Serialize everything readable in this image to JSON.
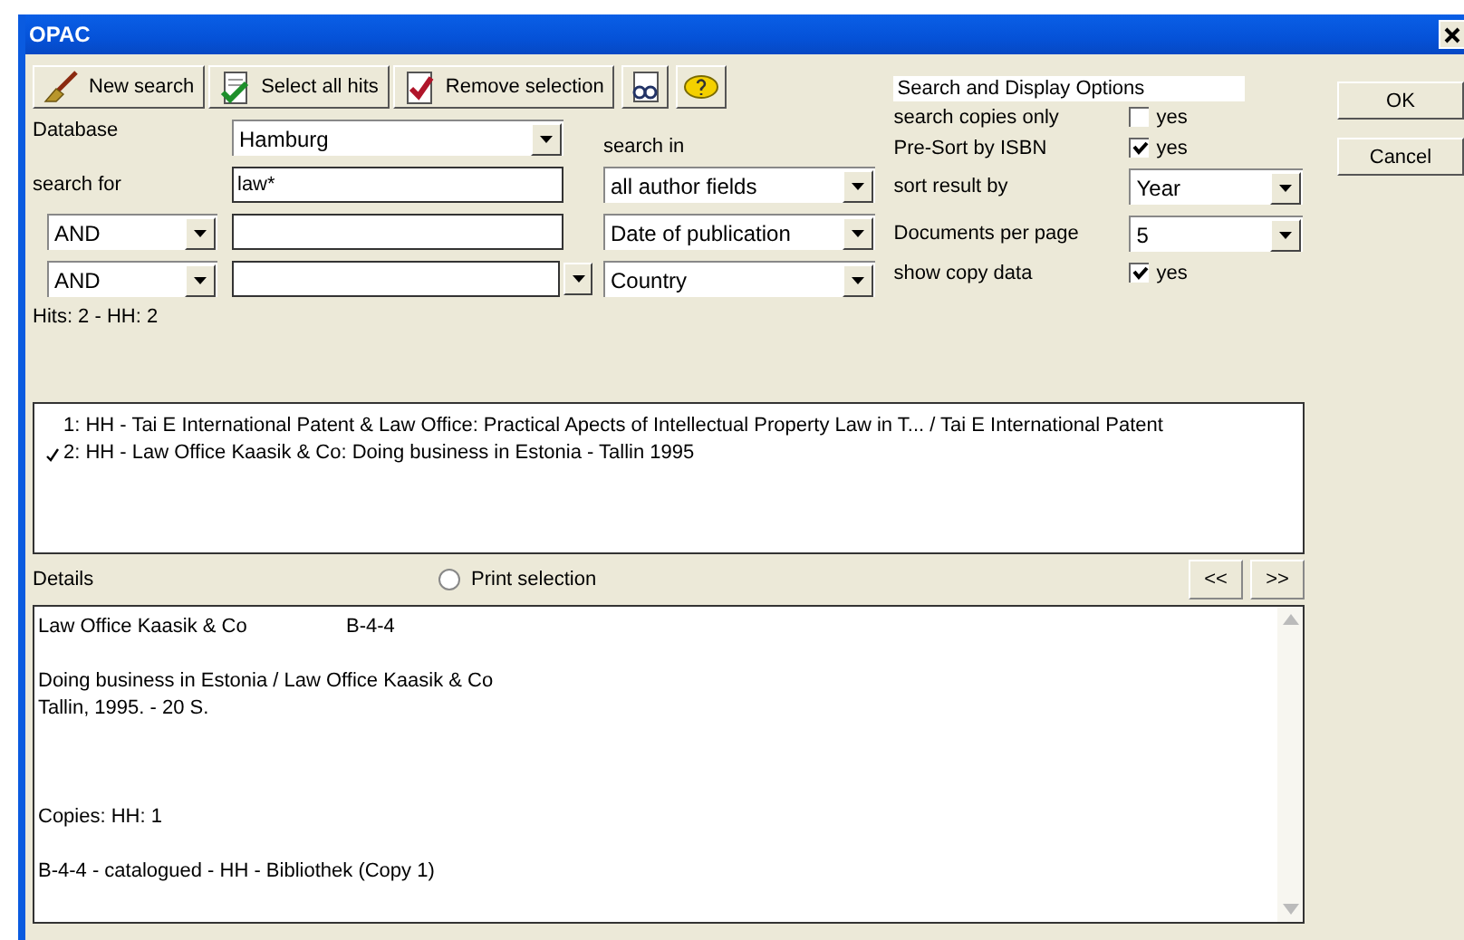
{
  "window": {
    "title": "OPAC"
  },
  "toolbar": {
    "buttons": [
      {
        "label": "New search"
      },
      {
        "label": "Select all hits"
      },
      {
        "label": "Remove selection"
      }
    ]
  },
  "search": {
    "database_label": "Database",
    "database": "Hamburg",
    "search_for_label": "search for",
    "query": "law*",
    "search_in_label": "search in",
    "rows": [
      {
        "field": "all author fields"
      },
      {
        "operator": "AND",
        "value": "",
        "field": "Date of publication"
      },
      {
        "operator": "AND",
        "value": "",
        "field": "Country"
      }
    ]
  },
  "options": {
    "title": "Search and Display Options",
    "rows": [
      {
        "kind": "checkbox",
        "label": "search copies only",
        "checked": false,
        "text": "yes"
      },
      {
        "kind": "checkbox",
        "label": "Pre-Sort by ISBN",
        "checked": true,
        "text": "yes"
      },
      {
        "kind": "select",
        "label": "sort result by",
        "value": "Year"
      },
      {
        "kind": "select",
        "label": "Documents per page",
        "value": "5"
      },
      {
        "kind": "checkbox",
        "label": "show copy data",
        "checked": true,
        "text": "yes"
      }
    ]
  },
  "dialog_buttons": [
    "OK",
    "Cancel"
  ],
  "hits_summary": "Hits: 2 - HH: 2",
  "hits": [
    {
      "text": "1: HH - Tai E International Patent & Law Office: Practical Apects of Intellectual Property Law in T... / Tai E International Patent",
      "selected": false
    },
    {
      "text": "2: HH - Law Office Kaasik & Co: Doing business in Estonia - Tallin 1995",
      "selected": true
    }
  ],
  "details": {
    "label": "Details",
    "print_selection": {
      "label": "Print selection",
      "selected": false
    },
    "nav": [
      "<<",
      ">>"
    ],
    "blocks": [
      {
        "lines": [
          [
            "Law Office Kaasik & Co",
            "B-4-4"
          ]
        ]
      },
      {
        "lines": [
          [
            "Doing business in Estonia / Law Office Kaasik & Co"
          ],
          [
            "Tallin, 1995. - 20 S."
          ]
        ]
      },
      {
        "lines": [
          [
            "Copies:  HH: 1"
          ]
        ]
      },
      {
        "lines": [
          [
            "B-4-4 - catalogued - HH - Bibliothek (Copy 1)"
          ]
        ]
      }
    ]
  }
}
